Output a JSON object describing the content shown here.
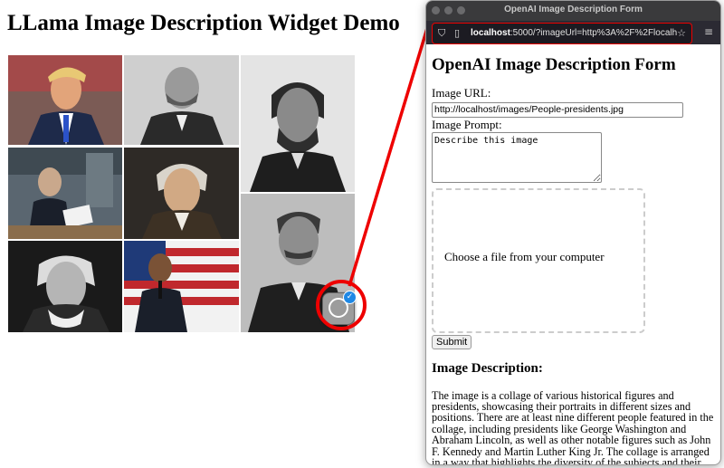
{
  "page": {
    "title": "LLama Image Description Widget Demo"
  },
  "collage": {
    "tiles": [
      {
        "name": "president-portrait-1"
      },
      {
        "name": "president-portrait-2"
      },
      {
        "name": "president-portrait-3"
      },
      {
        "name": "president-portrait-4"
      },
      {
        "name": "president-portrait-5"
      },
      {
        "name": "president-portrait-6"
      },
      {
        "name": "president-portrait-7"
      },
      {
        "name": "president-portrait-8"
      }
    ]
  },
  "widget": {
    "icon": "accessibility-person-icon",
    "badge_icon": "check-icon",
    "highlight_color": "#e00000"
  },
  "browser": {
    "window_title": "OpenAI Image Description Form",
    "url_host": "localhost",
    "url_rest": ":5000/?imageUrl=http%3A%2F%2Flocalh"
  },
  "form": {
    "heading": "OpenAI Image Description Form",
    "image_url_label": "Image URL:",
    "image_url_value": "http://localhost/images/People-presidents.jpg",
    "prompt_label": "Image Prompt:",
    "prompt_value": "Describe this image",
    "dropzone_text": "Choose a file from your computer",
    "submit_label": "Submit"
  },
  "result": {
    "heading": "Image Description:",
    "text": "The image is a collage of various historical figures and presidents, showcasing their portraits in different sizes and positions. There are at least nine different people featured in the collage, including presidents like George Washington and Abraham Lincoln, as well as other notable figures such as John F. Kennedy and Martin Luther King Jr. The collage is arranged in a way that highlights the diversity of the subjects and their importance in history."
  }
}
